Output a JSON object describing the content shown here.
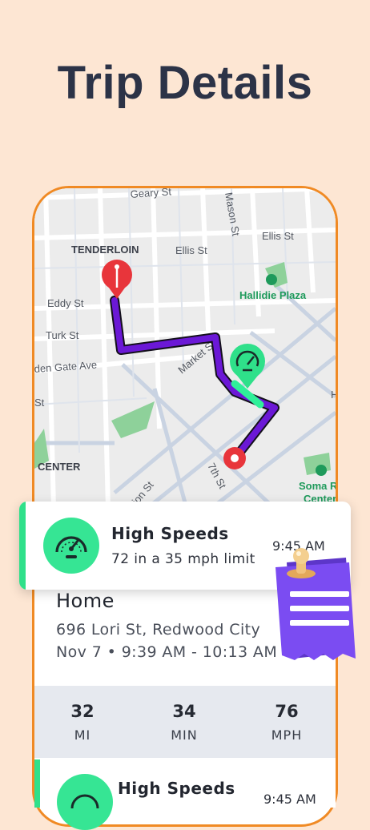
{
  "page": {
    "title": "Trip Details"
  },
  "map": {
    "streets": [
      "Geary St",
      "Mason St",
      "Ellis St",
      "Ellis St",
      "Eddy St",
      "Turk St",
      "den Gate Ave",
      "Market St",
      "7th St",
      "ion St",
      "St",
      "H",
      "St"
    ],
    "neighborhoods": [
      "TENDERLOIN",
      "CENTER"
    ],
    "places": [
      "Hallidie Plaza",
      "Soma Re",
      "Center"
    ]
  },
  "alert": {
    "title": "High Speeds",
    "detail": "72  in a 35 mph limit",
    "time": "9:45 AM",
    "icon": "speedometer-icon"
  },
  "trip": {
    "name": "Home",
    "address": "696 Lori St, Redwood City",
    "datetime": "Nov 7 • 9:39 AM - 10:13 AM"
  },
  "stats": [
    {
      "value": "32",
      "unit": "MI"
    },
    {
      "value": "34",
      "unit": "MIN"
    },
    {
      "value": "76",
      "unit": "MPH"
    }
  ],
  "next_alert": {
    "title": "High Speeds",
    "time": "9:45 AM"
  },
  "colors": {
    "background": "#fde6d3",
    "frame": "#f08a24",
    "accent_green": "#36e594",
    "route_purple": "#6b18d6",
    "start_pin_red": "#e8353b",
    "receipt_purple": "#7b4cf2"
  }
}
